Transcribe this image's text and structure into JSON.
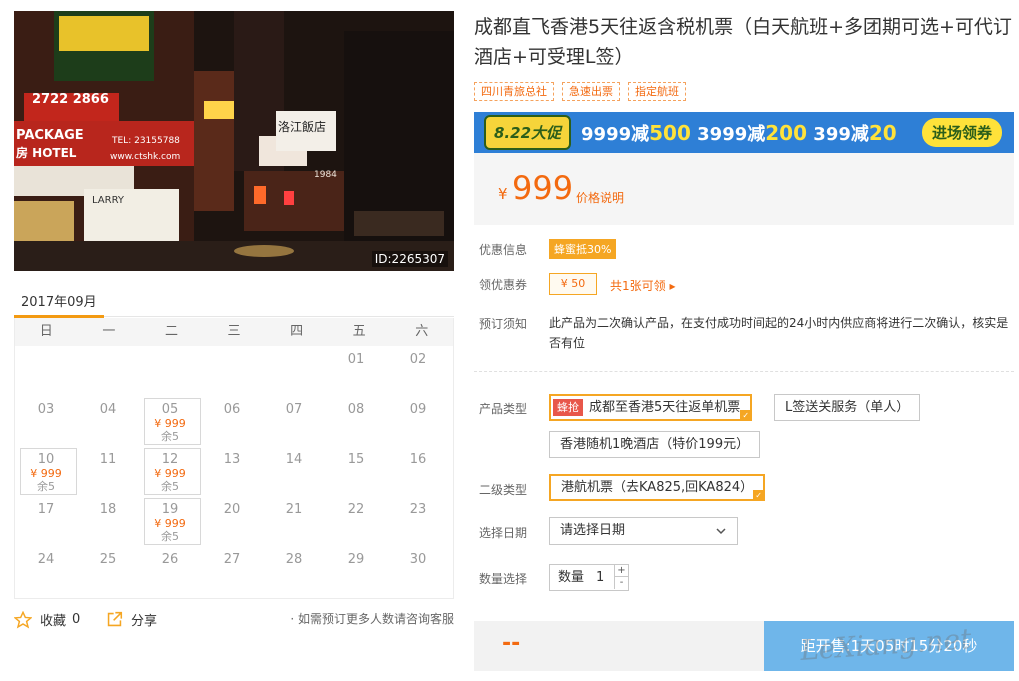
{
  "photo": {
    "image_id": "ID:2265307",
    "sign_texts": [
      "2722 2866",
      "PACKAGE",
      "房 HOTEL",
      "TEL: 23155788",
      "www.ctshk.com",
      "LARRY",
      "洛江飯店",
      "1984"
    ]
  },
  "calendar": {
    "month": "2017年09月",
    "weekdays": [
      "日",
      "一",
      "二",
      "三",
      "四",
      "五",
      "六"
    ],
    "days": [
      {
        "d": ""
      },
      {
        "d": ""
      },
      {
        "d": ""
      },
      {
        "d": ""
      },
      {
        "d": ""
      },
      {
        "d": "01"
      },
      {
        "d": "02"
      },
      {
        "d": "03"
      },
      {
        "d": "04"
      },
      {
        "d": "05",
        "price": "¥ 999",
        "remain": "余5"
      },
      {
        "d": "06"
      },
      {
        "d": "07"
      },
      {
        "d": "08"
      },
      {
        "d": "09"
      },
      {
        "d": "10",
        "price": "¥ 999",
        "remain": "余5"
      },
      {
        "d": "11"
      },
      {
        "d": "12",
        "price": "¥ 999",
        "remain": "余5"
      },
      {
        "d": "13"
      },
      {
        "d": "14"
      },
      {
        "d": "15"
      },
      {
        "d": "16"
      },
      {
        "d": "17"
      },
      {
        "d": "18"
      },
      {
        "d": "19",
        "price": "¥ 999",
        "remain": "余5"
      },
      {
        "d": "20"
      },
      {
        "d": "21"
      },
      {
        "d": "22"
      },
      {
        "d": "23"
      },
      {
        "d": "24"
      },
      {
        "d": "25"
      },
      {
        "d": "26"
      },
      {
        "d": "27"
      },
      {
        "d": "28"
      },
      {
        "d": "29"
      },
      {
        "d": "30"
      }
    ]
  },
  "actions": {
    "favorite_label": "收藏",
    "favorite_count": "0",
    "share_label": "分享",
    "note": "· 如需预订更多人数请咨询客服"
  },
  "product": {
    "title": "成都直飞香港5天往返含税机票（白天航班+多团期可选+可代订酒店+可受理L签）",
    "tags": [
      "四川青旅总社",
      "急速出票",
      "指定航班"
    ]
  },
  "banner": {
    "badge": "8.22大促",
    "promo_parts": [
      {
        "pre": "9999减",
        "num": "500"
      },
      {
        "pre": "3999减",
        "num": "200"
      },
      {
        "pre": "399减",
        "num": "20"
      }
    ],
    "button": "进场领券"
  },
  "price": {
    "currency": "¥",
    "amount": "999",
    "explain": "价格说明"
  },
  "info": {
    "discount_label": "优惠信息",
    "discount_badge": "蜂蜜抵30%",
    "coupon_label": "领优惠券",
    "coupon_value": "¥ 50",
    "coupon_link": "共1张可领 ▸",
    "notice_label": "预订须知",
    "notice_text": "此产品为二次确认产品，在支付成功时间起的24小时内供应商将进行二次确认，核实是否有位"
  },
  "options": {
    "product_type_label": "产品类型",
    "product_types": [
      {
        "flash": "蜂抢",
        "label": "成都至香港5天往返单机票"
      },
      {
        "label": "L签送关服务（单人）"
      },
      {
        "label": "香港随机1晚酒店（特价199元）"
      }
    ],
    "sub_type_label": "二级类型",
    "sub_type": "港航机票（去KA825,回KA824）",
    "date_label": "选择日期",
    "date_placeholder": "请选择日期",
    "qty_label": "数量选择",
    "qty_prefix": "数量",
    "qty_value": "1"
  },
  "bottom": {
    "price_placeholder": "--",
    "countdown": "距开售:1天05时15分20秒",
    "watermark": "LeXiang.net"
  },
  "colors": {
    "accent_orange": "#f36a10",
    "select_border": "#f5a623",
    "countdown_bg": "#6fb6ea",
    "banner_bg": "#2e7fd6"
  }
}
